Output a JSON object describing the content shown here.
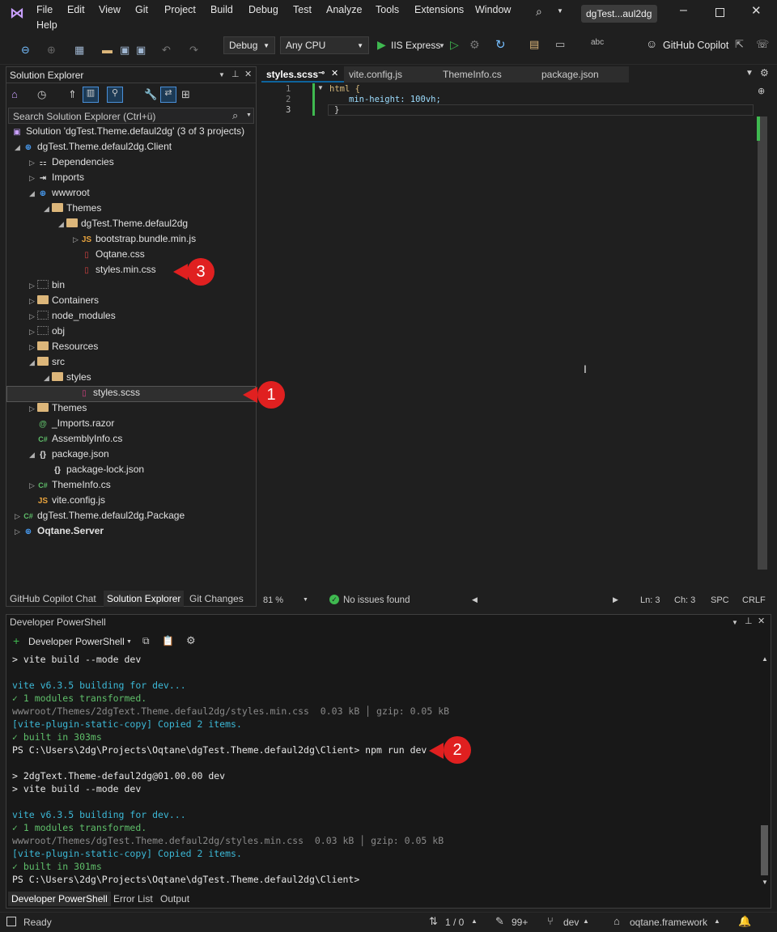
{
  "app": {
    "solution_title": "dgTest...aul2dg"
  },
  "menu": [
    "File",
    "Edit",
    "View",
    "Git",
    "Project",
    "Build",
    "Debug",
    "Test",
    "Analyze",
    "Tools",
    "Extensions",
    "Window",
    "Help"
  ],
  "toolbar": {
    "config": "Debug",
    "platform": "Any CPU",
    "run_target": "IIS Express",
    "copilot": "GitHub Copilot"
  },
  "solution_explorer": {
    "title": "Solution Explorer",
    "search_placeholder": "Search Solution Explorer (Ctrl+ü)",
    "rows": [
      {
        "label": "Solution 'dgTest.Theme.defaul2dg' (3 of 3 projects)"
      },
      {
        "label": "dgTest.Theme.defaul2dg.Client"
      },
      {
        "label": "Dependencies"
      },
      {
        "label": "Imports"
      },
      {
        "label": "wwwroot"
      },
      {
        "label": "Themes"
      },
      {
        "label": "dgTest.Theme.defaul2dg"
      },
      {
        "label": "bootstrap.bundle.min.js"
      },
      {
        "label": "Oqtane.css"
      },
      {
        "label": "styles.min.css"
      },
      {
        "label": "bin"
      },
      {
        "label": "Containers"
      },
      {
        "label": "node_modules"
      },
      {
        "label": "obj"
      },
      {
        "label": "Resources"
      },
      {
        "label": "src"
      },
      {
        "label": "styles"
      },
      {
        "label": "styles.scss"
      },
      {
        "label": "Themes"
      },
      {
        "label": "_Imports.razor"
      },
      {
        "label": "AssemblyInfo.cs"
      },
      {
        "label": "package.json"
      },
      {
        "label": "package-lock.json"
      },
      {
        "label": "ThemeInfo.cs"
      },
      {
        "label": "vite.config.js"
      },
      {
        "label": "dgTest.Theme.defaul2dg.Package"
      },
      {
        "label": "Oqtane.Server"
      }
    ],
    "bottom_tabs": [
      "GitHub Copilot Chat",
      "Solution Explorer",
      "Git Changes"
    ]
  },
  "editor": {
    "tabs": [
      "styles.scss",
      "vite.config.js",
      "ThemeInfo.cs",
      "package.json"
    ],
    "lines": [
      {
        "num": "1",
        "text": "html {"
      },
      {
        "num": "2",
        "text": "min-height: 100vh;"
      },
      {
        "num": "3",
        "text": "}"
      }
    ],
    "status": {
      "zoom": "81 %",
      "issues": "No issues found",
      "ln": "Ln: 3",
      "ch": "Ch: 3",
      "spc": "SPC",
      "crlf": "CRLF"
    }
  },
  "powershell": {
    "title": "Developer PowerShell",
    "shell_button": "Developer PowerShell",
    "lines": [
      {
        "t": "> vite build --mode dev",
        "c": ""
      },
      {
        "t": "",
        "c": ""
      },
      {
        "t": "vite v6.3.5 building for dev...",
        "c": "cyan"
      },
      {
        "t": "✓ 1 modules transformed.",
        "c": "green"
      },
      {
        "t": "wwwroot/Themes/2dgText.Theme.defaul2dg/styles.min.css  0.03 kB │ gzip: 0.05 kB",
        "c": "gray"
      },
      {
        "t": "[vite-plugin-static-copy] Copied 2 items.",
        "c": "cyan"
      },
      {
        "t": "✓ built in 303ms",
        "c": "green"
      },
      {
        "t": "PS C:\\Users\\2dg\\Projects\\Oqtane\\dgTest.Theme.defaul2dg\\Client> npm run dev",
        "c": ""
      },
      {
        "t": "",
        "c": ""
      },
      {
        "t": "> 2dgText.Theme-defaul2dg@01.00.00 dev",
        "c": ""
      },
      {
        "t": "> vite build --mode dev",
        "c": ""
      },
      {
        "t": "",
        "c": ""
      },
      {
        "t": "vite v6.3.5 building for dev...",
        "c": "cyan"
      },
      {
        "t": "✓ 1 modules transformed.",
        "c": "green"
      },
      {
        "t": "wwwroot/Themes/dgTest.Theme.defaul2dg/styles.min.css  0.03 kB │ gzip: 0.05 kB",
        "c": "gray"
      },
      {
        "t": "[vite-plugin-static-copy] Copied 2 items.",
        "c": "cyan"
      },
      {
        "t": "✓ built in 301ms",
        "c": "green"
      },
      {
        "t": "PS C:\\Users\\2dg\\Projects\\Oqtane\\dgTest.Theme.defaul2dg\\Client>",
        "c": ""
      }
    ],
    "bottom_tabs": [
      "Developer PowerShell",
      "Error List",
      "Output"
    ]
  },
  "statusbar": {
    "ready": "Ready",
    "position": "1 / 0",
    "edits": "99+",
    "branch": "dev",
    "repo": "oqtane.framework"
  },
  "annotations": [
    "1",
    "2",
    "3"
  ],
  "colors": {
    "accent": "#0e639c",
    "annotation_red": "#e02020"
  }
}
